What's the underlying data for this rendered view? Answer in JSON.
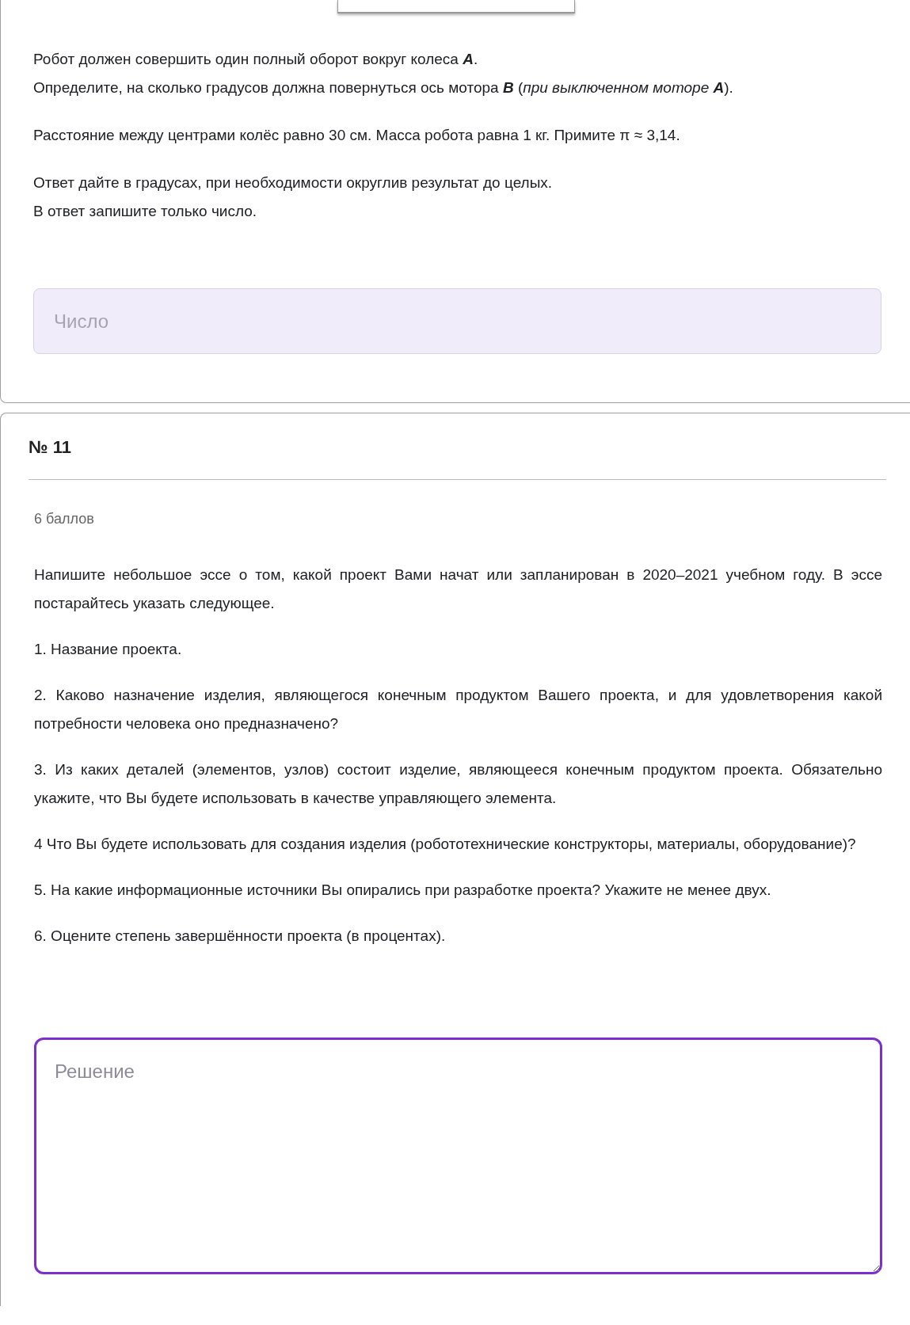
{
  "task_10": {
    "paragraphs": [
      [
        "Робот должен совершить один полный оборот вокруг колеса **A**.",
        "Определите, на сколько градусов должна повернуться ось мотора **B** (*при выключенном моторе* **A**)."
      ],
      [
        "Расстояние между центрами колёс равно 30 см. Масса робота равна 1 кг. Примите π ≈ 3,14."
      ],
      [
        "Ответ дайте в градусах, при необходимости округлив результат до целых.",
        "В ответ запишите только число."
      ]
    ],
    "answer_field": {
      "placeholder": "Число"
    }
  },
  "task_11": {
    "number": "№ 11",
    "points": "6 баллов",
    "paragraphs": [
      "Напишите небольшое эссе о том, какой проект Вами начат или запланирован в 2020–2021 учебном году. В эссе постарайтесь указать следующее.",
      "1. Название проекта.",
      "2. Каково назначение изделия, являющегося конечным продуктом Вашего проекта, и для удовлетворения какой потребности человека оно предназначено?",
      "3. Из каких деталей (элементов, узлов) состоит изделие, являющееся конечным продуктом проекта. Обязательно укажите, что Вы будете использовать в качестве управляющего элемента.",
      "4 Что Вы будете использовать для создания изделия (робототехнические конструкторы, материалы, оборудование)?",
      "5. На какие информационные источники Вы опирались при разработке проекта? Укажите не менее двух.",
      "6. Оцените степень завершённости проекта (в процентах)."
    ],
    "solution_field": {
      "placeholder": "Решение"
    }
  }
}
